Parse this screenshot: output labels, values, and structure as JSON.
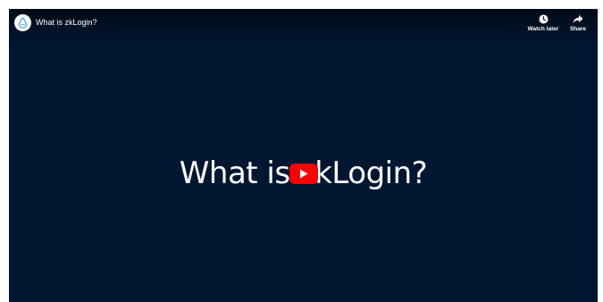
{
  "video": {
    "title": "What is zkLogin?",
    "center_title": "What is zkLogin?"
  },
  "actions": {
    "watch_later_label": "Watch later",
    "share_label": "Share"
  },
  "icons": {
    "channel_avatar": "sui-droplet-logo-icon",
    "watch_later": "clock-icon",
    "share": "share-arrow-icon",
    "play": "play-icon"
  },
  "colors": {
    "background": "#011631",
    "play_button": "#ff0000",
    "text": "#ffffff",
    "logo_blue": "#4da2ff"
  }
}
